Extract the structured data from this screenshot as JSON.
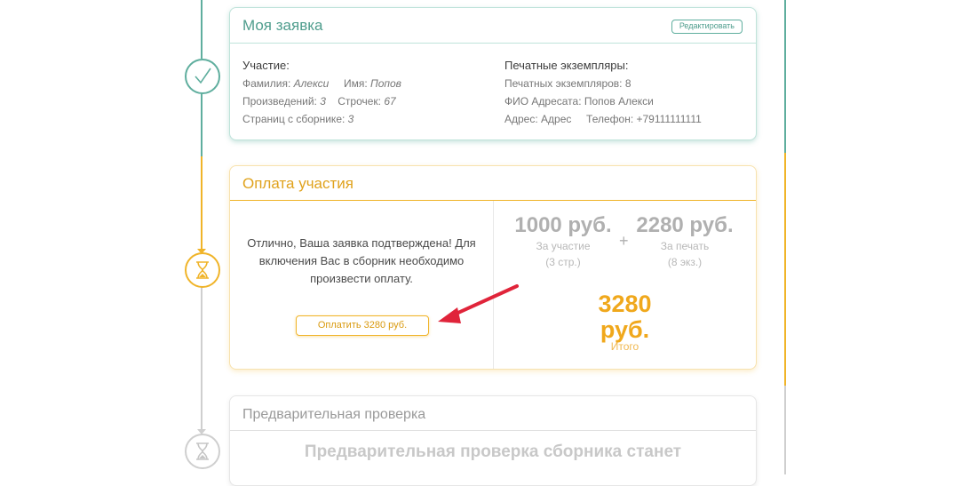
{
  "application": {
    "title": "Моя заявка",
    "edit_label": "Редактировать",
    "participation_head": "Участие:",
    "surname_label": "Фамилия:",
    "surname_value": "Алекси",
    "name_label": "Имя:",
    "name_value": "Попов",
    "works_label": "Произведений:",
    "works_value": "3",
    "lines_label": "Строчек:",
    "lines_value": "67",
    "pages_label": "Страниц с сборнике:",
    "pages_value": "3",
    "print_head": "Печатные экземпляры:",
    "copies_line": "Печатных экземпляров: 8",
    "recipient_line": "ФИО Адресата: Попов Алекси",
    "address_line": "Адрес: Адрес",
    "phone_line": "Телефон: +79111111111"
  },
  "payment": {
    "title": "Оплата участия",
    "message": "Отлично, Ваша заявка подтверждена! Для включения Вас в сборник необходимо произвести оплату.",
    "pay_button": "Оплатить 3280 руб.",
    "participation_amount": "1000 руб.",
    "participation_label": "За участие",
    "participation_detail": "(3 стр.)",
    "plus": "+",
    "print_amount": "2280 руб.",
    "print_label": "За печать",
    "print_detail": "(8 экз.)",
    "total_amount_line1": "3280",
    "total_amount_line2": "руб.",
    "total_label": "Итого"
  },
  "precheck": {
    "title": "Предварительная проверка",
    "body": "Предварительная проверка сборника станет"
  },
  "colors": {
    "teal": "#5fae9e",
    "orange": "#f0b429",
    "gray": "#cfcfcf",
    "red_arrow": "#e0243a"
  },
  "icons": {
    "done": "checkmark-icon",
    "pending": "hourglass-icon",
    "annotation": "red-arrow-icon"
  }
}
